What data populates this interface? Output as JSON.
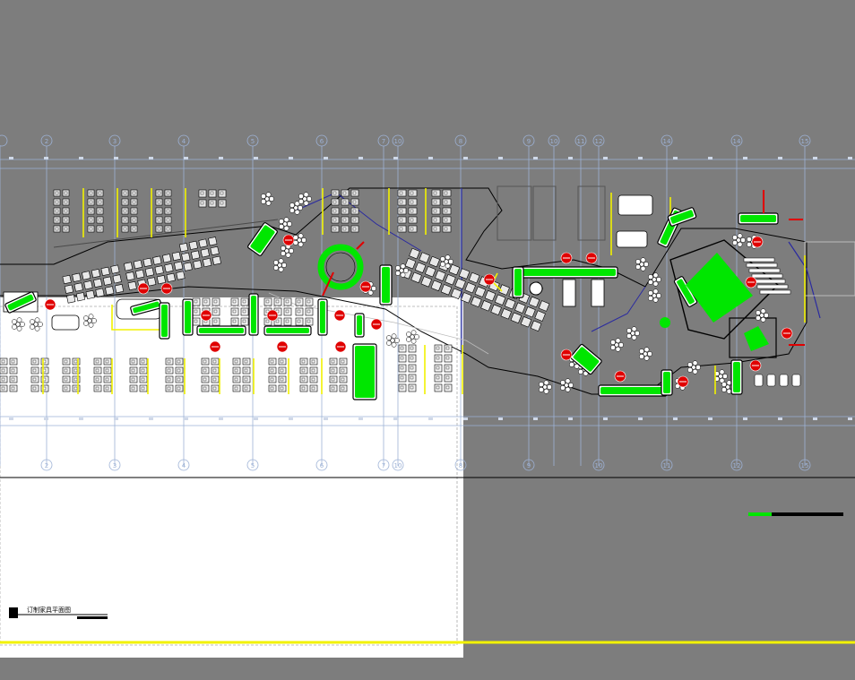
{
  "drawing": {
    "plan_title": "订制家具平面图"
  },
  "grid": {
    "top_labels": [
      "2",
      "3",
      "4",
      "5",
      "6",
      "7",
      "10",
      "8",
      "9",
      "10",
      "11",
      "12",
      "14",
      "14",
      "15"
    ],
    "bottom_labels": [
      "2",
      "3",
      "4",
      "5",
      "6",
      "7",
      "10",
      "8",
      "9",
      "10",
      "11",
      "12",
      "15"
    ]
  },
  "colors": {
    "canvas": "#7d7d7d",
    "paper": "#ffffff",
    "grid_line": "#9db2d6",
    "furniture_highlight": "#00e600",
    "tag_marker": "#e00000",
    "partition": "#f2f200",
    "linework": "#000000"
  },
  "layers": [
    "grid",
    "walls",
    "workstations",
    "custom-furniture",
    "markers",
    "title-block"
  ]
}
